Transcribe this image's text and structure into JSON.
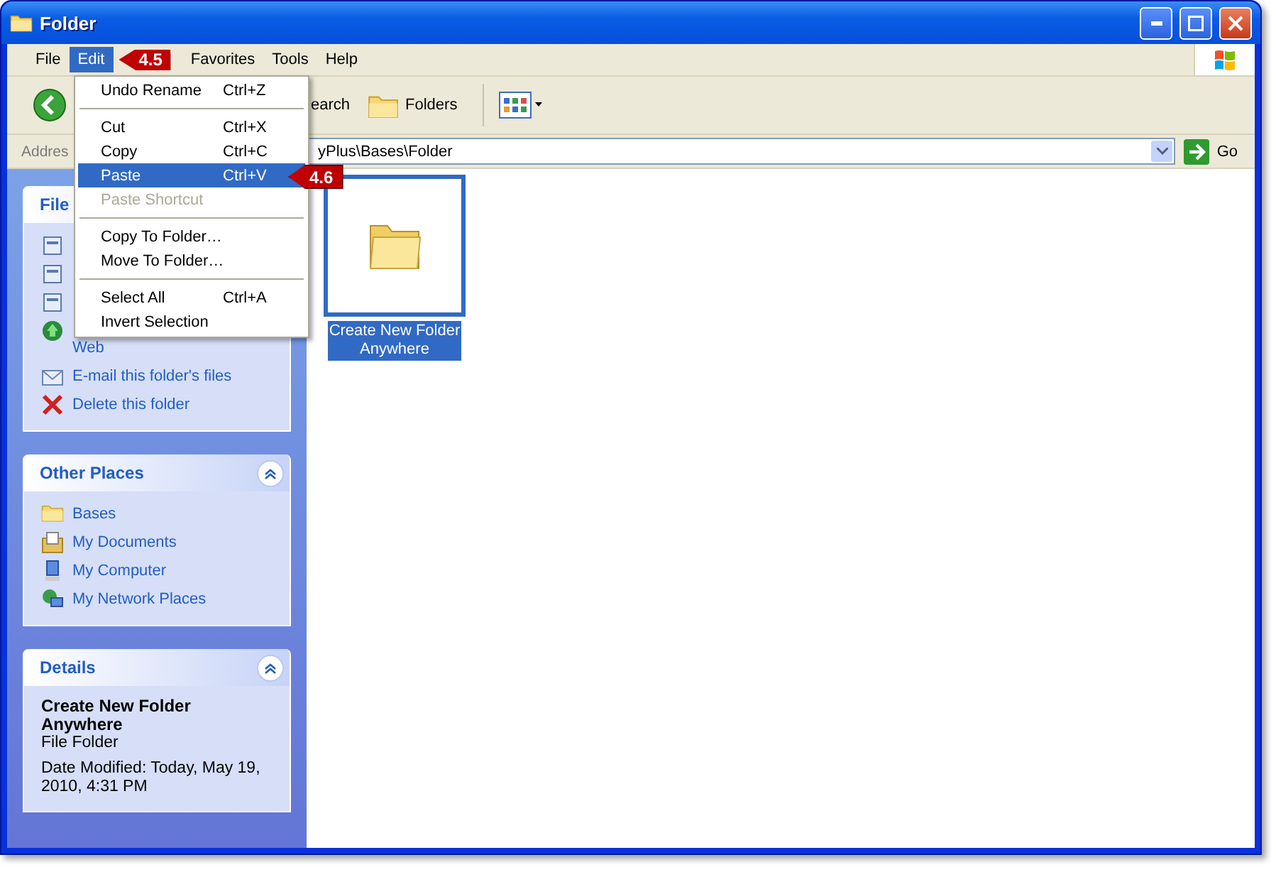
{
  "window": {
    "title": "Folder"
  },
  "menu_bar": [
    {
      "label": "File",
      "selected": false
    },
    {
      "label": "Edit",
      "selected": true,
      "callout": "4.5"
    },
    {
      "label": "Favorites",
      "selected": false
    },
    {
      "label": "Tools",
      "selected": false
    },
    {
      "label": "Help",
      "selected": false
    }
  ],
  "edit_menu": [
    {
      "kind": "item",
      "label": "Undo Rename",
      "shortcut": "Ctrl+Z",
      "selected": false,
      "disabled": false
    },
    {
      "kind": "separator"
    },
    {
      "kind": "item",
      "label": "Cut",
      "shortcut": "Ctrl+X",
      "selected": false,
      "disabled": false
    },
    {
      "kind": "item",
      "label": "Copy",
      "shortcut": "Ctrl+C",
      "selected": false,
      "disabled": false
    },
    {
      "kind": "item",
      "label": "Paste",
      "shortcut": "Ctrl+V",
      "selected": true,
      "disabled": false,
      "callout": "4.6"
    },
    {
      "kind": "item",
      "label": "Paste Shortcut",
      "selected": false,
      "disabled": true
    },
    {
      "kind": "separator"
    },
    {
      "kind": "item",
      "label": "Copy To Folder…",
      "selected": false,
      "disabled": false
    },
    {
      "kind": "item",
      "label": "Move To Folder…",
      "selected": false,
      "disabled": false
    },
    {
      "kind": "separator"
    },
    {
      "kind": "item",
      "label": "Select All",
      "shortcut": "Ctrl+A",
      "selected": false,
      "disabled": false
    },
    {
      "kind": "item",
      "label": "Invert Selection",
      "selected": false,
      "disabled": false
    }
  ],
  "toolbar": {
    "search_label": "earch",
    "folders_label": "Folders"
  },
  "address_bar": {
    "label": "Addres",
    "value": "yPlus\\Bases\\Folder",
    "go_label": "Go"
  },
  "file_tasks": {
    "title": "File",
    "items": [
      {
        "kind": "web",
        "label": "Web"
      },
      {
        "kind": "email",
        "label": "E-mail this folder's files"
      },
      {
        "kind": "delete",
        "label": "Delete this folder"
      }
    ]
  },
  "other_places": {
    "title": "Other Places",
    "items": [
      {
        "kind": "folder",
        "label": "Bases"
      },
      {
        "kind": "documents",
        "label": "My Documents"
      },
      {
        "kind": "computer",
        "label": "My Computer"
      },
      {
        "kind": "network",
        "label": "My Network Places"
      }
    ]
  },
  "details": {
    "title": "Details",
    "name": "Create New Folder Anywhere",
    "type": "File Folder",
    "modified": "Date Modified: Today, May 19, 2010, 4:31 PM"
  },
  "files": [
    {
      "name": "Create New Folder Anywhere",
      "selected": true
    }
  ]
}
